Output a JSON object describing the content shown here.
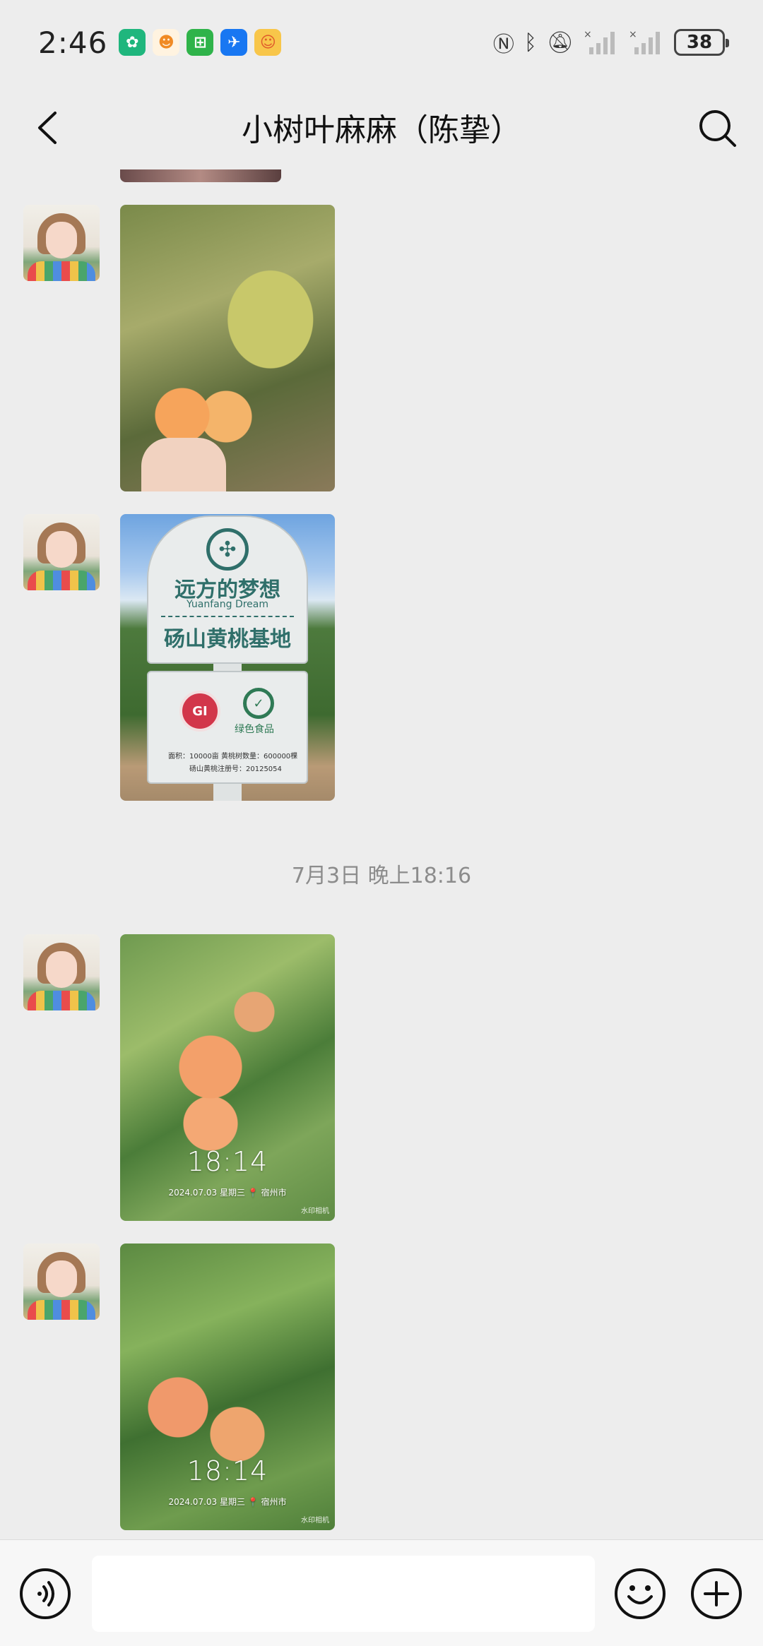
{
  "status_bar": {
    "time": "2:46",
    "battery": "38",
    "notification_icons": [
      "app-icon-green",
      "app-icon-orange",
      "app-icon-green-2",
      "app-icon-blue",
      "app-icon-yellow"
    ]
  },
  "header": {
    "title": "小树叶麻麻（陈挚）"
  },
  "messages": [
    {
      "type": "image",
      "image": "peach-branch-photo"
    },
    {
      "type": "image",
      "image": "orchard-sign-photo",
      "sign": {
        "line1": "远方的梦想",
        "line2": "Yuanfang Dream",
        "line3": "砀山黄桃基地",
        "gi_badge": "GI",
        "green_label": "绿色食品",
        "small_line1": "面积：10000亩    黄桃树数量：600000棵",
        "small_line2": "砀山黄桃注册号：20125054"
      }
    },
    {
      "type": "timestamp",
      "text": "7月3日 晚上18:16"
    },
    {
      "type": "image",
      "image": "peach-tree-photo-1",
      "stamp": {
        "time": "18:14",
        "info": "2024.07.03  星期三  📍 宿州市",
        "mark": "水印相机"
      }
    },
    {
      "type": "image",
      "image": "peach-tree-photo-2",
      "stamp": {
        "time": "18:14",
        "info": "2024.07.03  星期三  📍 宿州市",
        "mark": "水印相机"
      }
    }
  ],
  "input_bar": {
    "placeholder": ""
  },
  "colors": {
    "background": "#ededed",
    "input_bar": "#f7f7f7",
    "timestamp_text": "#8c8c8c"
  }
}
